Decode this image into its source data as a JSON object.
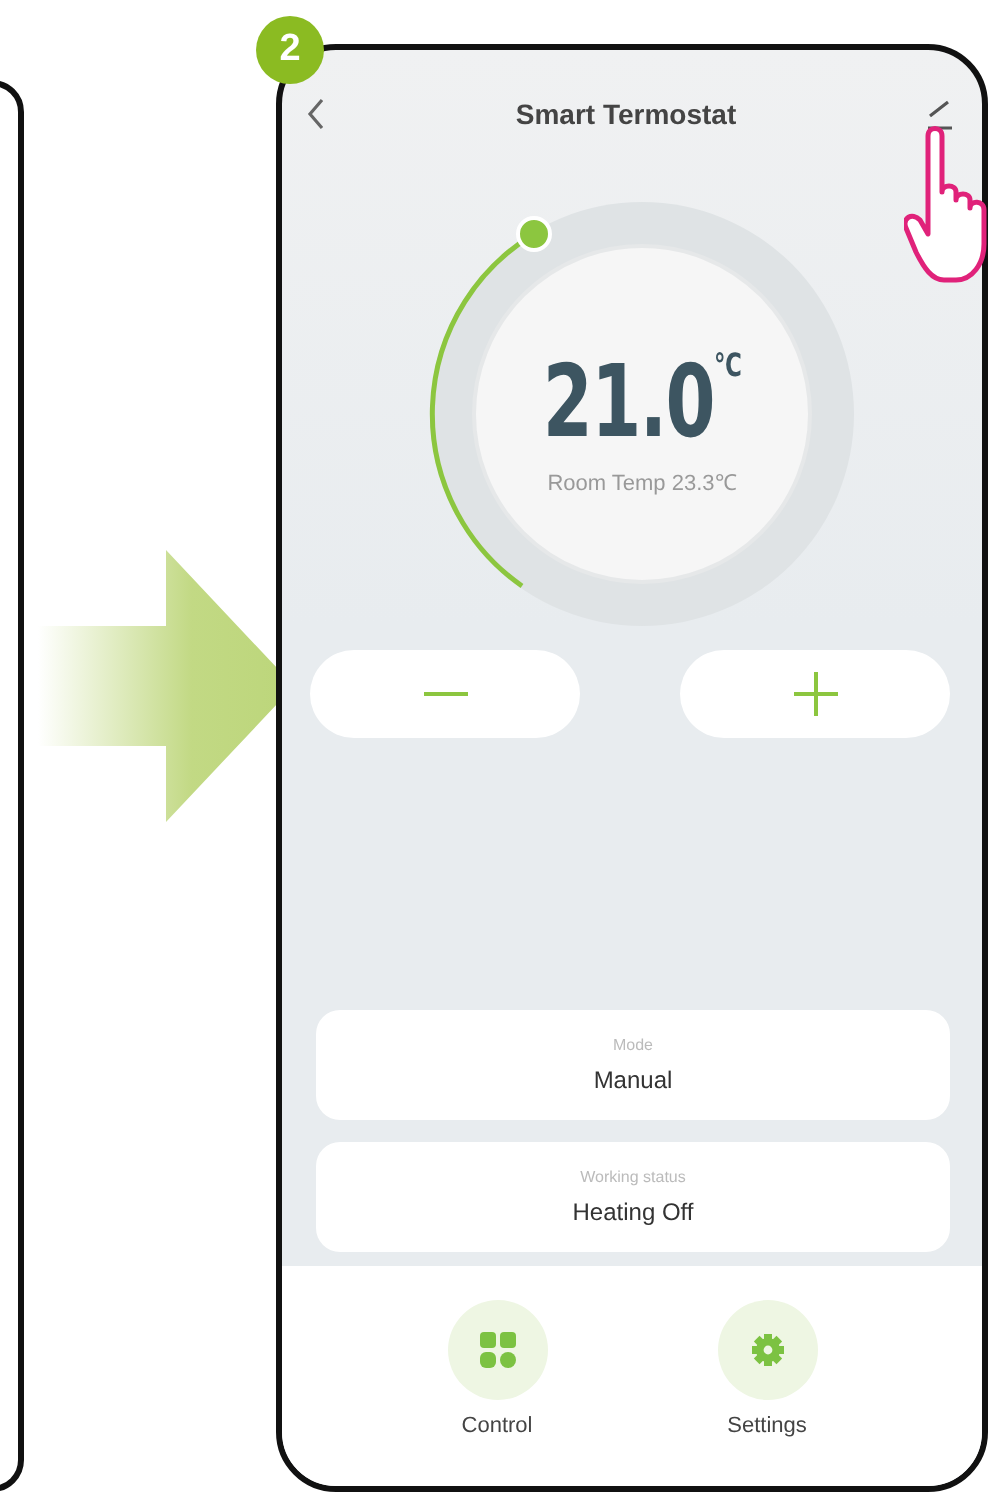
{
  "step_badge": "2",
  "header": {
    "title": "Smart Termostat"
  },
  "dial": {
    "setpoint": "21.0",
    "unit": "℃",
    "room_temp": "Room Temp 23.3℃"
  },
  "info_cards": [
    {
      "label": "Mode",
      "value": "Manual"
    },
    {
      "label": "Working status",
      "value": "Heating Off"
    }
  ],
  "bottom_nav": [
    {
      "kind": "control",
      "label": "Control"
    },
    {
      "kind": "settings",
      "label": "Settings"
    }
  ]
}
